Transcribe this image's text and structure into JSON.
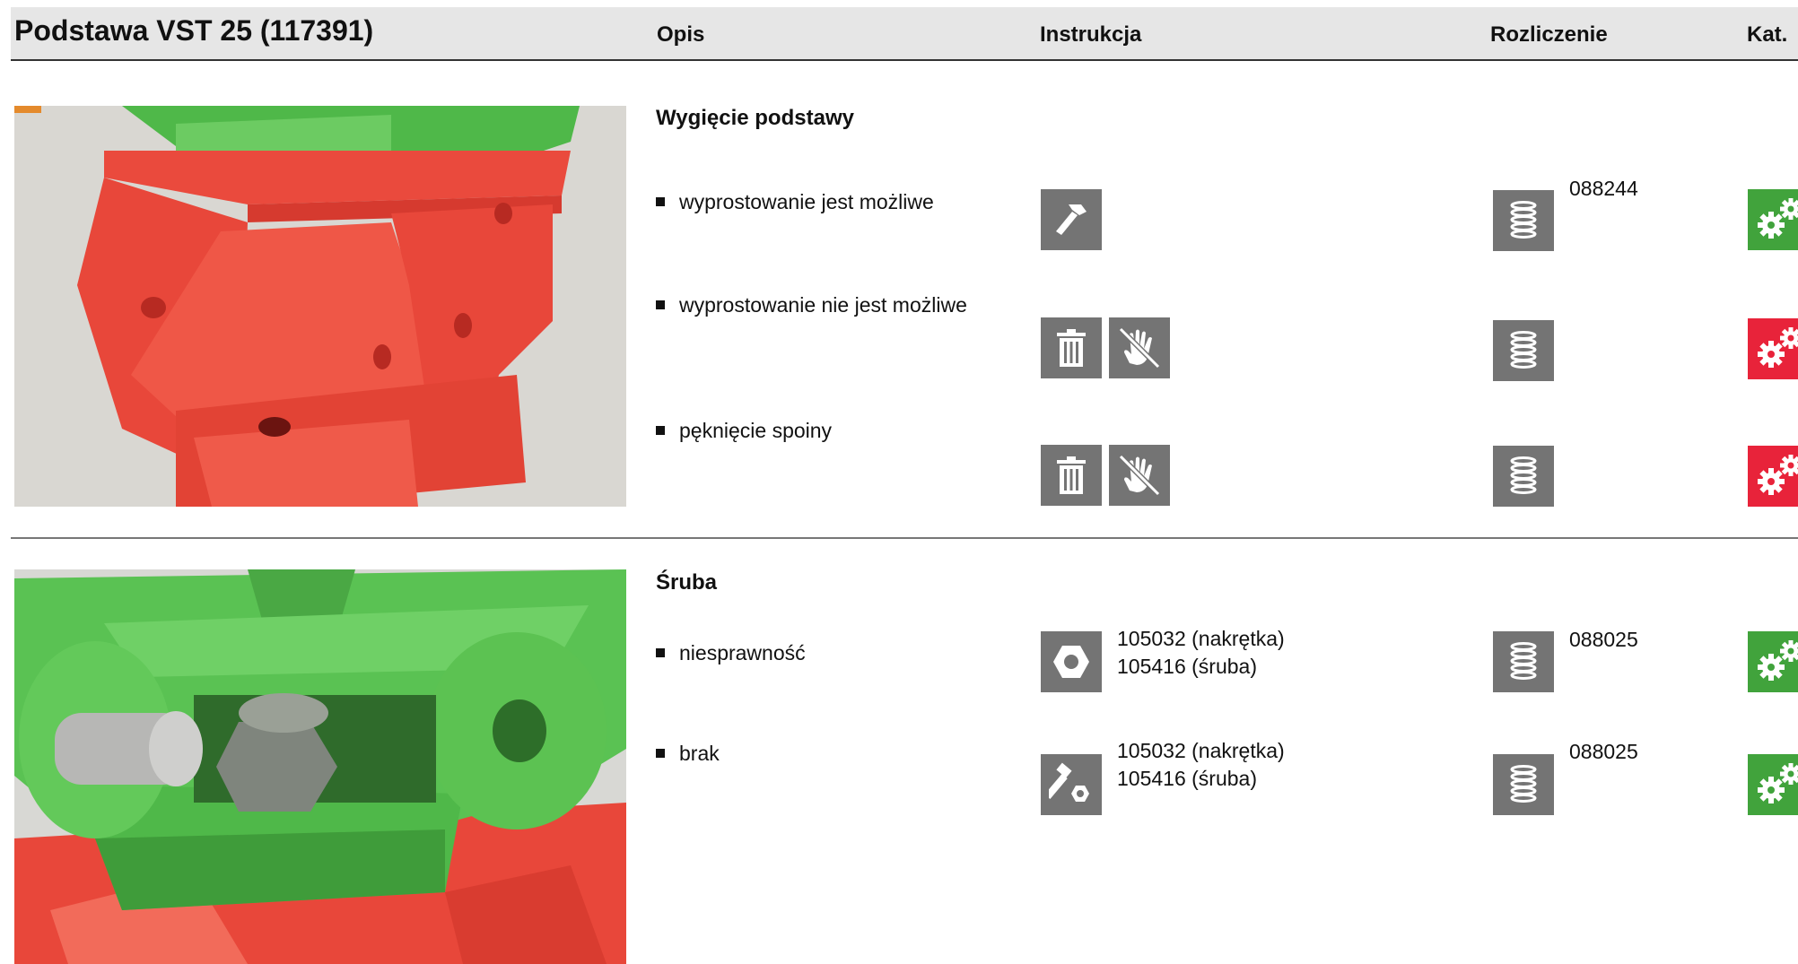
{
  "header": {
    "title": "Podstawa VST 25 (117391)",
    "col_opis": "Opis",
    "col_instrukcja": "Instrukcja",
    "col_rozliczenie": "Rozliczenie",
    "col_kat": "Kat."
  },
  "section1": {
    "title": "Wygięcie podstawy",
    "items": [
      {
        "label": "wyprostowanie jest możliwe",
        "instr_icons": [
          "hammer-icon"
        ],
        "billing_icon": "coil-spring-icon",
        "billing_code": "088244",
        "kat": "green"
      },
      {
        "label": "wyprostowanie nie jest możliwe",
        "instr_icons": [
          "trash-icon",
          "no-repair-hand-icon"
        ],
        "billing_icon": "coil-spring-icon",
        "billing_code": "",
        "kat": "red"
      },
      {
        "label": "pęknięcie spoiny",
        "instr_icons": [
          "trash-icon",
          "no-repair-hand-icon"
        ],
        "billing_icon": "coil-spring-icon",
        "billing_code": "",
        "kat": "red"
      }
    ]
  },
  "section2": {
    "title": "Śruba",
    "items": [
      {
        "label": "niesprawność",
        "instr_icons": [
          "nut-icon"
        ],
        "part_line1": "105032 (nakrętka)",
        "part_line2": "105416 (śruba)",
        "billing_icon": "coil-spring-icon",
        "billing_code": "088025",
        "kat": "green"
      },
      {
        "label": "brak",
        "instr_icons": [
          "bolt-nut-icon"
        ],
        "part_line1": "105032 (nakrętka)",
        "part_line2": "105416 (śruba)",
        "billing_icon": "coil-spring-icon",
        "billing_code": "088025",
        "kat": "green"
      }
    ]
  },
  "colors": {
    "kat_green": "#41a33c",
    "kat_red": "#e8233a",
    "icon_grey": "#747474",
    "header_bg": "#e6e6e6"
  }
}
